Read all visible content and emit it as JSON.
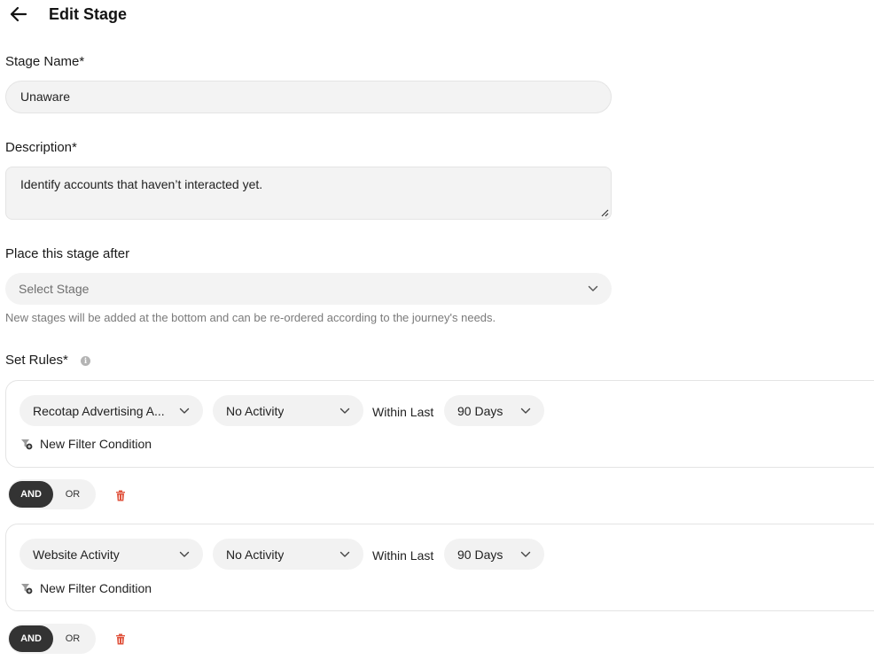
{
  "header": {
    "title": "Edit Stage"
  },
  "form": {
    "stage_name_label": "Stage Name*",
    "stage_name_value": "Unaware",
    "description_label": "Description*",
    "description_value": "Identify accounts that haven’t interacted yet.",
    "place_after_label": "Place this stage after",
    "place_after_placeholder": "Select Stage",
    "place_after_helper": "New stages will be added at the bottom and can be re-ordered according to the journey's needs.",
    "rules_label": "Set Rules*",
    "rules_info_glyph": "i"
  },
  "rules": [
    {
      "source": "Recotap Advertising A...",
      "activity": "No Activity",
      "within_label": "Within Last",
      "period": "90 Days",
      "filter_label": "New Filter Condition",
      "and_label": "AND",
      "or_label": "OR"
    },
    {
      "source": "Website Activity",
      "activity": "No Activity",
      "within_label": "Within Last",
      "period": "90 Days",
      "filter_label": "New Filter Condition",
      "and_label": "AND",
      "or_label": "OR"
    }
  ],
  "colors": {
    "toggle_active": "#333333",
    "trash": "#e0533d",
    "field_bg": "#f3f3f3"
  },
  "icons": {
    "back": "arrow-left",
    "chevron": "chevron-down",
    "info": "info-circle",
    "filter": "filter-plus",
    "delete": "trash"
  }
}
